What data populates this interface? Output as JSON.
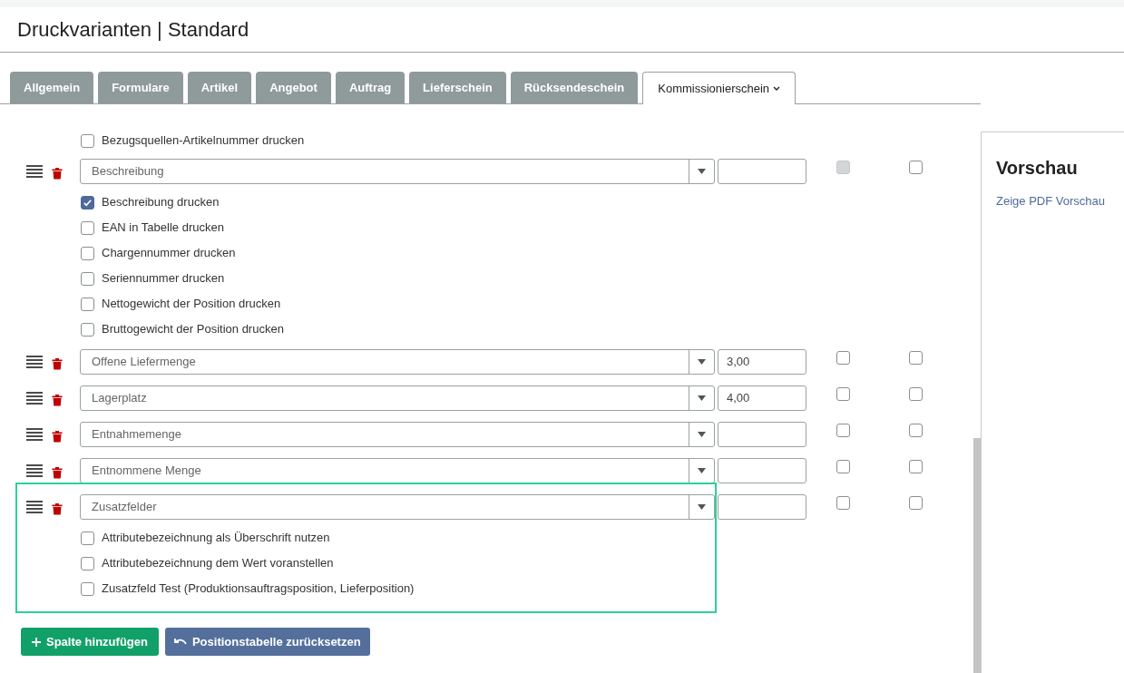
{
  "page_title": "Druckvarianten | Standard",
  "tabs": [
    {
      "label": "Allgemein",
      "selected": false
    },
    {
      "label": "Formulare",
      "selected": false
    },
    {
      "label": "Artikel",
      "selected": false
    },
    {
      "label": "Angebot",
      "selected": false
    },
    {
      "label": "Auftrag",
      "selected": false
    },
    {
      "label": "Lieferschein",
      "selected": false
    },
    {
      "label": "Rücksendeschein",
      "selected": false
    },
    {
      "label": "Kommissionierschein",
      "selected": true
    }
  ],
  "leading_options": [
    {
      "label": "Bezugsquellen-Artikelnummer drucken",
      "checked": false
    }
  ],
  "rows": [
    {
      "field": "Beschreibung",
      "value": "",
      "highlighted": false,
      "check_1": {
        "checked": false,
        "disabled": true
      },
      "check_2": {
        "checked": false,
        "disabled": false
      },
      "options": [
        {
          "label": "Beschreibung drucken",
          "checked": true
        },
        {
          "label": "EAN in Tabelle drucken",
          "checked": false
        },
        {
          "label": "Chargennummer drucken",
          "checked": false
        },
        {
          "label": "Seriennummer drucken",
          "checked": false
        },
        {
          "label": "Nettogewicht der Position drucken",
          "checked": false
        },
        {
          "label": "Bruttogewicht der Position drucken",
          "checked": false
        }
      ]
    },
    {
      "field": "Offene Liefermenge",
      "value": "3,00",
      "highlighted": false,
      "check_1": {
        "checked": false,
        "disabled": false
      },
      "check_2": {
        "checked": false,
        "disabled": false
      },
      "options": []
    },
    {
      "field": "Lagerplatz",
      "value": "4,00",
      "highlighted": false,
      "check_1": {
        "checked": false,
        "disabled": false
      },
      "check_2": {
        "checked": false,
        "disabled": false
      },
      "options": []
    },
    {
      "field": "Entnahmemenge",
      "value": "",
      "highlighted": false,
      "check_1": {
        "checked": false,
        "disabled": false
      },
      "check_2": {
        "checked": false,
        "disabled": false
      },
      "options": []
    },
    {
      "field": "Entnommene Menge",
      "value": "",
      "highlighted": false,
      "check_1": {
        "checked": false,
        "disabled": false
      },
      "check_2": {
        "checked": false,
        "disabled": false
      },
      "options": []
    },
    {
      "field": "Zusatzfelder",
      "value": "",
      "highlighted": true,
      "check_1": {
        "checked": false,
        "disabled": false
      },
      "check_2": {
        "checked": false,
        "disabled": false
      },
      "options": [
        {
          "label": "Attributebezeichnung als Überschrift nutzen",
          "checked": false
        },
        {
          "label": "Attributebezeichnung dem Wert voranstellen",
          "checked": false
        },
        {
          "label": "Zusatzfeld Test (Produktionsauftragsposition, Lieferposition)",
          "checked": false
        }
      ]
    }
  ],
  "buttons": {
    "add": "Spalte hinzufügen",
    "reset": "Positionstabelle zurücksetzen"
  },
  "preview": {
    "title": "Vorschau",
    "link": "Zeige PDF Vorschau"
  }
}
